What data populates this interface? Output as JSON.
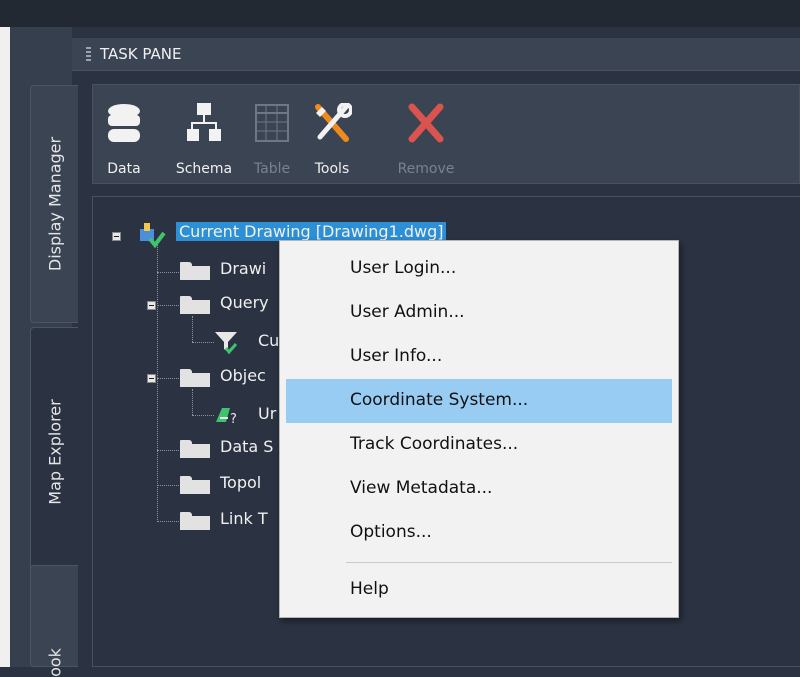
{
  "pane": {
    "title": "TASK PANE"
  },
  "side_tabs": [
    {
      "label": "Display Manager"
    },
    {
      "label": "Map Explorer"
    },
    {
      "label": "ook"
    }
  ],
  "toolbar": [
    {
      "label": "Data",
      "icon": "database-icon",
      "enabled": true
    },
    {
      "label": "Schema",
      "icon": "schema-icon",
      "enabled": true
    },
    {
      "label": "Table",
      "icon": "table-icon",
      "enabled": false
    },
    {
      "label": "Tools",
      "icon": "tools-icon",
      "enabled": true
    },
    {
      "label": "Remove",
      "icon": "remove-icon",
      "enabled": false
    }
  ],
  "tree": {
    "root": "Current Drawing [Drawing1.dwg]",
    "items": [
      "Drawi",
      "Query",
      "Cu",
      "Objec",
      "Ur",
      "Data S",
      "Topol",
      "Link T"
    ]
  },
  "context_menu": {
    "items": [
      "User Login...",
      "User Admin...",
      "User Info...",
      "Coordinate System...",
      "Track Coordinates...",
      "View Metadata...",
      "Options...",
      "Help"
    ],
    "highlighted": "Coordinate System..."
  },
  "colors": {
    "background": "#2b3241",
    "selection": "#2d8fd5",
    "menu_hover": "#99ccf3",
    "remove_red": "#d9534f"
  }
}
